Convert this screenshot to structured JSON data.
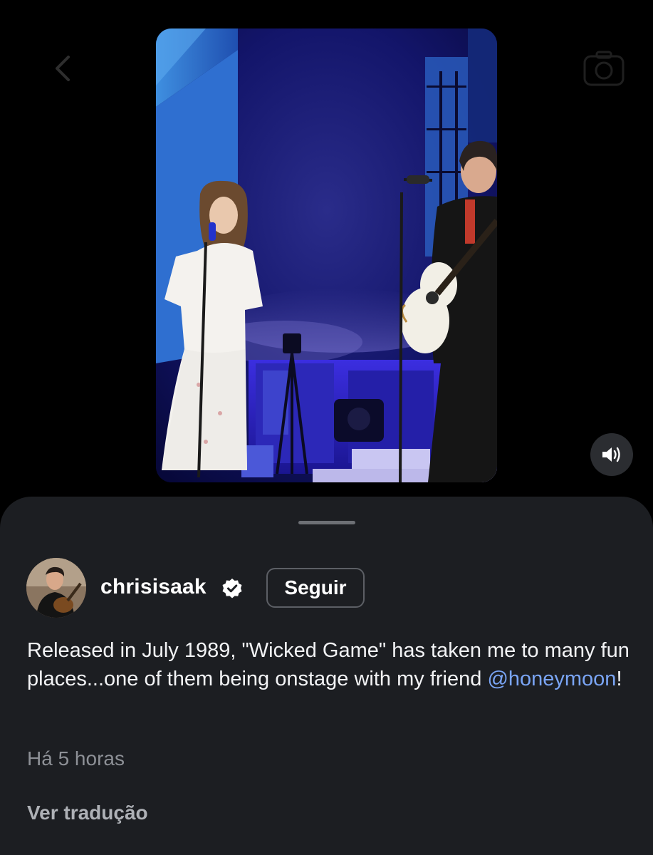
{
  "header": {
    "back_icon": "chevron-left-icon",
    "camera_icon": "camera-icon"
  },
  "video": {
    "sound_icon": "speaker-on-icon"
  },
  "post": {
    "username": "chrisisaak",
    "verified_icon": "verified-badge-icon",
    "follow_label": "Seguir",
    "caption_before": "Released in July 1989, \"Wicked Game\" has taken me to many fun places...one of them being onstage with my friend ",
    "caption_mention": "@honeymoon",
    "caption_after": "!",
    "time_ago": "Há 5 horas",
    "translate_label": "Ver tradução"
  },
  "colors": {
    "background": "#000000",
    "sheet": "#1c1e22",
    "mention": "#7aa5f5",
    "muted_text": "#8d9096"
  }
}
